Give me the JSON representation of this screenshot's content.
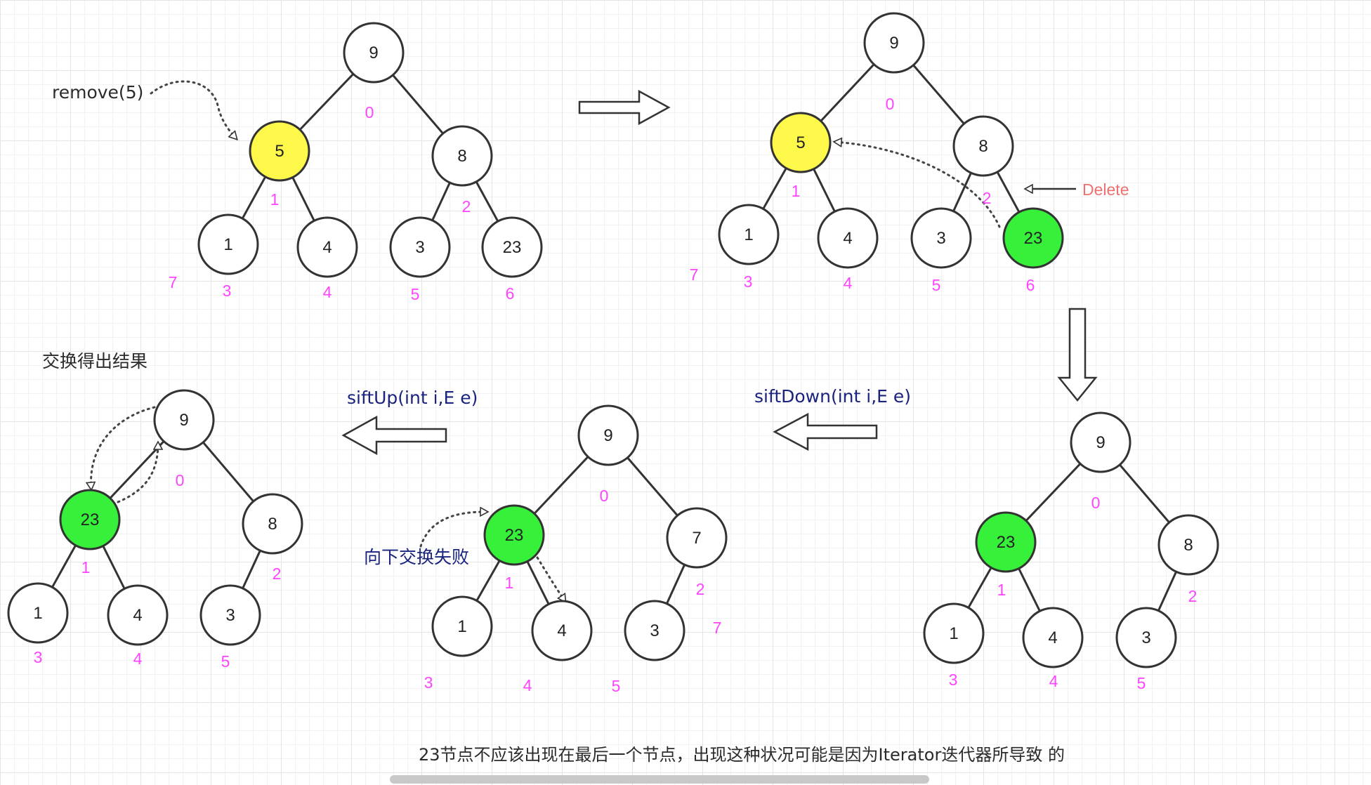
{
  "annotations": {
    "remove": "remove(5)",
    "delete": "Delete",
    "result": "交换得出结果",
    "sift_up": "siftUp(int i,E e)",
    "sift_down": "siftDown(int i,E e)",
    "swap_fail": "向下交换失败",
    "footer": "23节点不应该出现在最后一个节点，出现这种状况可能是因为Iterator迭代器所导致 的"
  },
  "colors": {
    "highlight_yellow": "#fdf84a",
    "highlight_green": "#37f03a",
    "node_fill": "#ffffff",
    "index_text": "#ff44ff",
    "blue_text": "#1a237e",
    "delete_text": "#f07070"
  },
  "trees": {
    "t1": {
      "nodes": [
        {
          "id": "n0",
          "label": "9",
          "index": "0",
          "fill": "white"
        },
        {
          "id": "n1",
          "label": "5",
          "index": "1",
          "fill": "yellow"
        },
        {
          "id": "n2",
          "label": "8",
          "index": "2",
          "fill": "white"
        },
        {
          "id": "n3",
          "label": "1",
          "index": "3",
          "fill": "white"
        },
        {
          "id": "n4",
          "label": "4",
          "index": "4",
          "fill": "white"
        },
        {
          "id": "n5",
          "label": "3",
          "index": "5",
          "fill": "white"
        },
        {
          "id": "n6",
          "label": "23",
          "index": "6",
          "fill": "white"
        }
      ],
      "extra_index": "7"
    },
    "t2": {
      "nodes": [
        {
          "id": "n0",
          "label": "9",
          "index": "0",
          "fill": "white"
        },
        {
          "id": "n1",
          "label": "5",
          "index": "1",
          "fill": "yellow"
        },
        {
          "id": "n2",
          "label": "8",
          "index": "2",
          "fill": "white"
        },
        {
          "id": "n3",
          "label": "1",
          "index": "3",
          "fill": "white"
        },
        {
          "id": "n4",
          "label": "4",
          "index": "4",
          "fill": "white"
        },
        {
          "id": "n5",
          "label": "3",
          "index": "5",
          "fill": "white"
        },
        {
          "id": "n6",
          "label": "23",
          "index": "6",
          "fill": "green"
        }
      ],
      "extra_index": "7"
    },
    "t3": {
      "nodes": [
        {
          "id": "n0",
          "label": "9",
          "index": "0",
          "fill": "white"
        },
        {
          "id": "n1",
          "label": "23",
          "index": "1",
          "fill": "green"
        },
        {
          "id": "n2",
          "label": "8",
          "index": "2",
          "fill": "white"
        },
        {
          "id": "n3",
          "label": "1",
          "index": "3",
          "fill": "white"
        },
        {
          "id": "n4",
          "label": "4",
          "index": "4",
          "fill": "white"
        },
        {
          "id": "n5",
          "label": "3",
          "index": "5",
          "fill": "white"
        }
      ]
    },
    "t4": {
      "nodes": [
        {
          "id": "n0",
          "label": "9",
          "index": "0",
          "fill": "white"
        },
        {
          "id": "n1",
          "label": "23",
          "index": "1",
          "fill": "green"
        },
        {
          "id": "n2",
          "label": "7",
          "index": "2",
          "fill": "white"
        },
        {
          "id": "n3",
          "label": "1",
          "index": "3",
          "fill": "white"
        },
        {
          "id": "n4",
          "label": "4",
          "index": "4",
          "fill": "white"
        },
        {
          "id": "n5",
          "label": "3",
          "index": "5",
          "fill": "white"
        }
      ],
      "extra_index": "7"
    },
    "t5": {
      "nodes": [
        {
          "id": "n0",
          "label": "9",
          "index": "0",
          "fill": "white"
        },
        {
          "id": "n1",
          "label": "23",
          "index": "1",
          "fill": "green"
        },
        {
          "id": "n2",
          "label": "8",
          "index": "2",
          "fill": "white"
        },
        {
          "id": "n3",
          "label": "1",
          "index": "3",
          "fill": "white"
        },
        {
          "id": "n4",
          "label": "4",
          "index": "4",
          "fill": "white"
        },
        {
          "id": "n5",
          "label": "3",
          "index": "5",
          "fill": "white"
        }
      ]
    }
  }
}
